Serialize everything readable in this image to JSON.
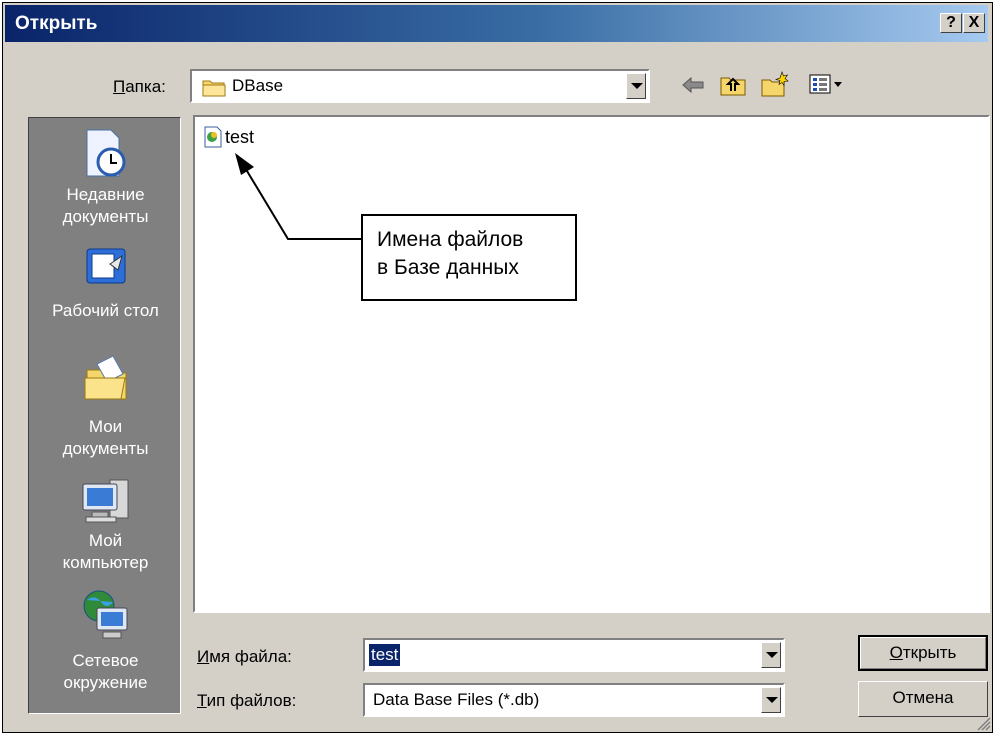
{
  "window": {
    "title": "Открыть",
    "help_btn": "?",
    "close_btn": "X"
  },
  "folder": {
    "label_u": "П",
    "label_rest": "апка:",
    "current": "DBase"
  },
  "places": [
    {
      "line1": "Недавние",
      "line2": "документы"
    },
    {
      "line1": "Рабочий стол",
      "line2": ""
    },
    {
      "line1": "Мои",
      "line2": "документы"
    },
    {
      "line1": "Мой",
      "line2": "компьютер"
    },
    {
      "line1": "Сетевое",
      "line2": "окружение"
    }
  ],
  "files": [
    {
      "name": "test"
    }
  ],
  "annotation": {
    "line1": "Имена файлов",
    "line2": "в Базе данных"
  },
  "filename": {
    "label_u": "И",
    "label_rest": "мя файла:",
    "value": "test"
  },
  "filetype": {
    "label_u": "Т",
    "label_rest": "ип файлов:",
    "value": "Data Base Files (*.db)"
  },
  "buttons": {
    "open_u": "О",
    "open_rest": "ткрыть",
    "cancel": "Отмена"
  },
  "colors": {
    "title_start": "#0a246a",
    "title_end": "#a6caf0",
    "selection": "#0a246a",
    "face": "#d4d0c8"
  }
}
